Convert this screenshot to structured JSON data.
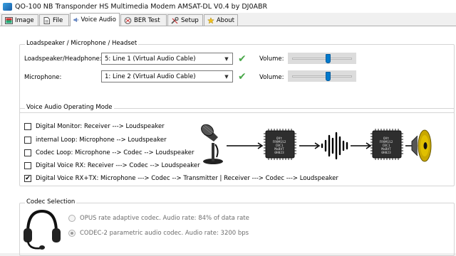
{
  "window": {
    "title": "QO-100 NB Transponder HS Multimedia Modem AMSAT-DL V0.4 by DJ0ABR"
  },
  "tabs": [
    {
      "label": "Image",
      "icon": "image-icon"
    },
    {
      "label": "File",
      "icon": "file-icon"
    },
    {
      "label": "Voice Audio",
      "icon": "speaker-icon",
      "active": true
    },
    {
      "label": "BER Test",
      "icon": "ber-icon"
    },
    {
      "label": "Setup",
      "icon": "tools-icon"
    },
    {
      "label": "About",
      "icon": "star-icon"
    }
  ],
  "audio_devices": {
    "group_title": "Loadspeaker / Microphone / Headset",
    "speaker_label": "Loadspeaker/Headphone:",
    "speaker_value": "5: Line 1 (Virtual Audio Cable)",
    "mic_label": "Microphone:",
    "mic_value": "1: Line 2 (Virtual Audio Cable)",
    "volume_label": "Volume:",
    "speaker_volume": 0.6,
    "mic_volume": 0.6
  },
  "modes": {
    "group_title": "Voice Audio Operating Mode",
    "items": [
      {
        "label": "Digital Monitor: Receiver ---> Loudspeaker",
        "checked": false
      },
      {
        "label": "internal Loop: Microphone --> Loudspeaker",
        "checked": false
      },
      {
        "label": "Codec Loop:  Microphone --> Codec --> Loudspeaker",
        "checked": false
      },
      {
        "label": "Digital Voice RX:        Receiver ---> Codec --> Loudspeaker",
        "checked": false
      },
      {
        "label": "Digital Voice RX+TX: Microphone ---> Codec --> Transmitter   |   Receiver ---> Codec ---> Loudspeaker",
        "checked": true
      }
    ],
    "chip_text": "QVt\nFR9M1S2\nCBC1\nMaBVT\n0H023"
  },
  "codec": {
    "group_title": "Codec Selection",
    "options": [
      {
        "label": "OPUS rate adaptive codec. Audio rate: 84% of data rate",
        "checked": false
      },
      {
        "label": "CODEC-2 parametric audio codec. Audio rate: 3200 bps",
        "checked": true
      }
    ]
  },
  "colors": {
    "accent": "#007acc",
    "check_green": "#4aa84a",
    "speaker_cone": "#e0c000"
  }
}
